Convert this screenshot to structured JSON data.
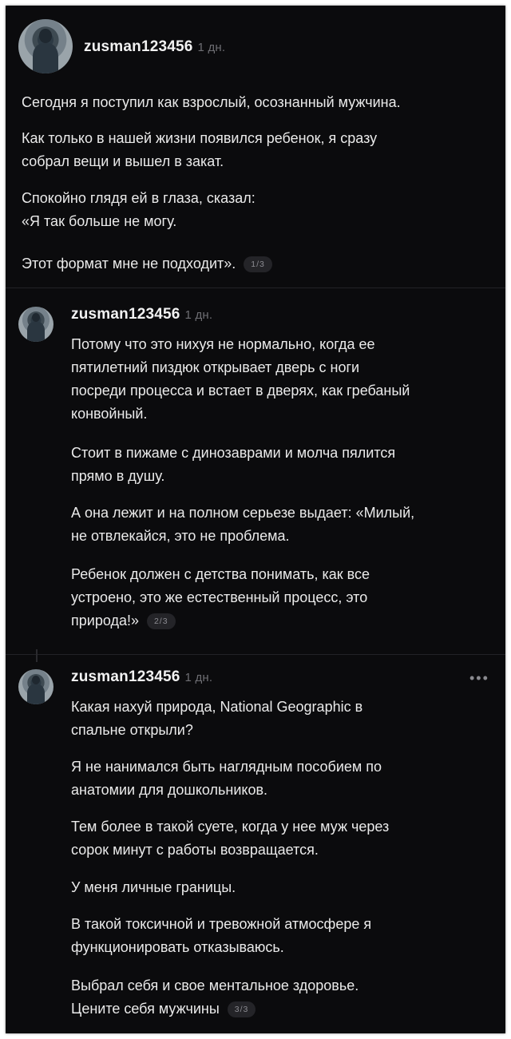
{
  "posts": [
    {
      "username": "zusman123456",
      "age": "1 дн.",
      "paragraphs": [
        [
          "Сегодня я поступил как взрослый, осознанный мужчина."
        ],
        [
          "Как только в нашей жизни появился ребенок, я сразу",
          "собрал вещи и вышел в закат."
        ],
        [
          "Спокойно глядя ей в глаза, сказал:",
          "«Я так больше не могу."
        ],
        [
          "Этот формат мне не подходит»."
        ]
      ],
      "counter": "1/3"
    },
    {
      "username": "zusman123456",
      "age": "1 дн.",
      "paragraphs": [
        [
          "Потому что это нихуя не нормально, когда ее",
          "пятилетний пиздюк открывает дверь с ноги",
          "посреди процесса и встает в дверях, как гребаный",
          "конвойный."
        ],
        [
          "Стоит в пижаме с динозаврами и молча пялится",
          "прямо в душу."
        ],
        [
          "А она лежит и на полном серьезе выдает: «Милый,",
          "не отвлекайся, это не проблема."
        ],
        [
          "Ребенок должен с детства понимать, как все",
          "устроено, это же естественный процесс, это",
          "природа!»"
        ]
      ],
      "counter": "2/3"
    },
    {
      "username": "zusman123456",
      "age": "1 дн.",
      "more": "•••",
      "paragraphs": [
        [
          "Какая нахуй природа, National Geographic в",
          "спальне открыли?"
        ],
        [
          "Я не нанимался быть наглядным пособием по",
          "анатомии для дошкольников."
        ],
        [
          "Тем более в такой суете, когда у нее муж через",
          "сорок минут с работы возвращается."
        ],
        [
          "У меня личные границы."
        ],
        [
          "В такой токсичной и тревожной атмосфере я",
          "функционировать отказываюсь."
        ],
        [
          "Выбрал себя и свое ментальное здоровье.",
          "Цените себя мужчины"
        ]
      ],
      "counter": "3/3"
    }
  ]
}
